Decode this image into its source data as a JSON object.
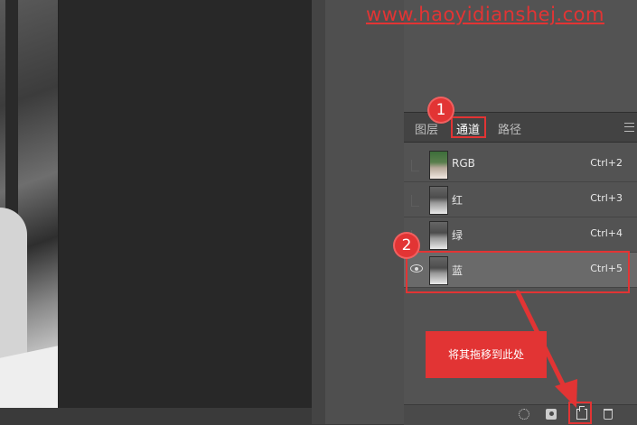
{
  "watermark": "www.haoyidianshej.com",
  "tabs": {
    "layers": "图层",
    "channels": "通道",
    "paths": "路径"
  },
  "channels": [
    {
      "name": "RGB",
      "shortcut": "Ctrl+2",
      "visible": false
    },
    {
      "name": "红",
      "shortcut": "Ctrl+3",
      "visible": false
    },
    {
      "name": "绿",
      "shortcut": "Ctrl+4",
      "visible": false
    },
    {
      "name": "蓝",
      "shortcut": "Ctrl+5",
      "visible": true,
      "selected": true
    }
  ],
  "annotations": {
    "badge1": "1",
    "badge2": "2",
    "callout": "将其拖移到此处"
  },
  "toolbar_icons": [
    "dotted-circle-icon",
    "mask-icon",
    "new-channel-icon",
    "trash-icon"
  ],
  "colors": {
    "annotation_red": "#e23434",
    "panel_bg": "#535353",
    "selected_row": "#6a6a6a"
  }
}
